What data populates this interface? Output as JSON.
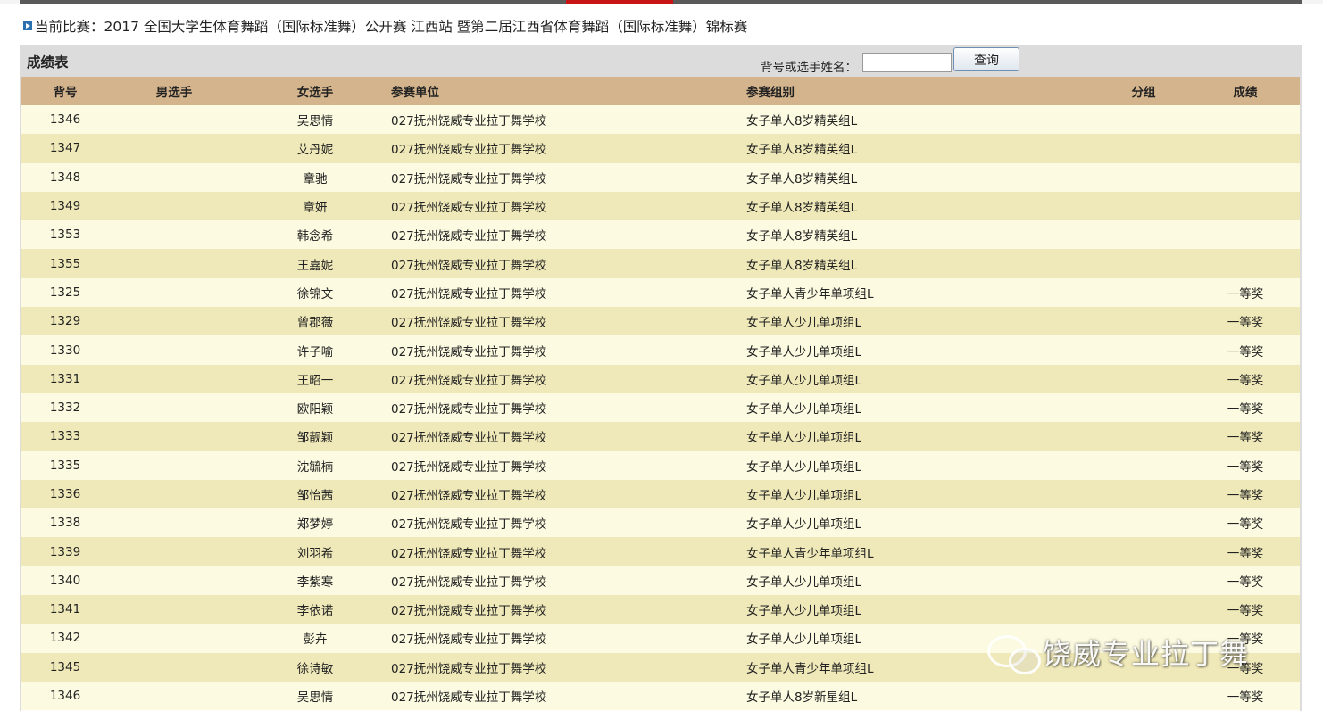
{
  "competition": {
    "prefix": "当前比赛：",
    "name": "2017 全国大学生体育舞蹈（国际标准舞）公开赛  江西站  暨第二届江西省体育舞蹈（国际标准舞）锦标赛"
  },
  "panel": {
    "title": "成绩表",
    "search_label": "背号或选手姓名：",
    "search_value": "",
    "search_button": "查询"
  },
  "table": {
    "columns": [
      "背号",
      "男选手",
      "女选手",
      "参赛单位",
      "参赛组别",
      "分组",
      "成绩"
    ],
    "rows": [
      {
        "no": "1346",
        "male": "",
        "female": "吴思情",
        "unit": "027抚州饶威专业拉丁舞学校",
        "group": "女子单人8岁精英组L",
        "sub": "",
        "result": ""
      },
      {
        "no": "1347",
        "male": "",
        "female": "艾丹妮",
        "unit": "027抚州饶威专业拉丁舞学校",
        "group": "女子单人8岁精英组L",
        "sub": "",
        "result": ""
      },
      {
        "no": "1348",
        "male": "",
        "female": "章驰",
        "unit": "027抚州饶威专业拉丁舞学校",
        "group": "女子单人8岁精英组L",
        "sub": "",
        "result": ""
      },
      {
        "no": "1349",
        "male": "",
        "female": "章妍",
        "unit": "027抚州饶威专业拉丁舞学校",
        "group": "女子单人8岁精英组L",
        "sub": "",
        "result": ""
      },
      {
        "no": "1353",
        "male": "",
        "female": "韩念希",
        "unit": "027抚州饶威专业拉丁舞学校",
        "group": "女子单人8岁精英组L",
        "sub": "",
        "result": ""
      },
      {
        "no": "1355",
        "male": "",
        "female": "王嘉妮",
        "unit": "027抚州饶威专业拉丁舞学校",
        "group": "女子单人8岁精英组L",
        "sub": "",
        "result": ""
      },
      {
        "no": "1325",
        "male": "",
        "female": "徐锦文",
        "unit": "027抚州饶威专业拉丁舞学校",
        "group": "女子单人青少年单项组L",
        "sub": "",
        "result": "一等奖"
      },
      {
        "no": "1329",
        "male": "",
        "female": "曾郡薇",
        "unit": "027抚州饶威专业拉丁舞学校",
        "group": "女子单人少儿单项组L",
        "sub": "",
        "result": "一等奖"
      },
      {
        "no": "1330",
        "male": "",
        "female": "许子喻",
        "unit": "027抚州饶威专业拉丁舞学校",
        "group": "女子单人少儿单项组L",
        "sub": "",
        "result": "一等奖"
      },
      {
        "no": "1331",
        "male": "",
        "female": "王昭一",
        "unit": "027抚州饶威专业拉丁舞学校",
        "group": "女子单人少儿单项组L",
        "sub": "",
        "result": "一等奖"
      },
      {
        "no": "1332",
        "male": "",
        "female": "欧阳颖",
        "unit": "027抚州饶威专业拉丁舞学校",
        "group": "女子单人少儿单项组L",
        "sub": "",
        "result": "一等奖"
      },
      {
        "no": "1333",
        "male": "",
        "female": "邹靓颖",
        "unit": "027抚州饶威专业拉丁舞学校",
        "group": "女子单人少儿单项组L",
        "sub": "",
        "result": "一等奖"
      },
      {
        "no": "1335",
        "male": "",
        "female": "沈毓楠",
        "unit": "027抚州饶威专业拉丁舞学校",
        "group": "女子单人少儿单项组L",
        "sub": "",
        "result": "一等奖"
      },
      {
        "no": "1336",
        "male": "",
        "female": "邹怡茜",
        "unit": "027抚州饶威专业拉丁舞学校",
        "group": "女子单人少儿单项组L",
        "sub": "",
        "result": "一等奖"
      },
      {
        "no": "1338",
        "male": "",
        "female": "郑梦婷",
        "unit": "027抚州饶威专业拉丁舞学校",
        "group": "女子单人少儿单项组L",
        "sub": "",
        "result": "一等奖"
      },
      {
        "no": "1339",
        "male": "",
        "female": "刘羽希",
        "unit": "027抚州饶威专业拉丁舞学校",
        "group": "女子单人青少年单项组L",
        "sub": "",
        "result": "一等奖"
      },
      {
        "no": "1340",
        "male": "",
        "female": "李紫寒",
        "unit": "027抚州饶威专业拉丁舞学校",
        "group": "女子单人少儿单项组L",
        "sub": "",
        "result": "一等奖"
      },
      {
        "no": "1341",
        "male": "",
        "female": "李依诺",
        "unit": "027抚州饶威专业拉丁舞学校",
        "group": "女子单人少儿单项组L",
        "sub": "",
        "result": "一等奖"
      },
      {
        "no": "1342",
        "male": "",
        "female": "彭卉",
        "unit": "027抚州饶威专业拉丁舞学校",
        "group": "女子单人少儿单项组L",
        "sub": "",
        "result": "一等奖"
      },
      {
        "no": "1345",
        "male": "",
        "female": "徐诗敏",
        "unit": "027抚州饶威专业拉丁舞学校",
        "group": "女子单人青少年单项组L",
        "sub": "",
        "result": "一等奖"
      },
      {
        "no": "1346",
        "male": "",
        "female": "吴思情",
        "unit": "027抚州饶威专业拉丁舞学校",
        "group": "女子单人8岁新星组L",
        "sub": "",
        "result": "一等奖"
      }
    ]
  },
  "watermark": {
    "icon": "wechat-icon",
    "text": "饶威专业拉丁舞"
  },
  "colors": {
    "header_bg": "#d4b48c",
    "row_light": "#fcfae0",
    "row_dark": "#efe8b8",
    "panel_bg": "#dcdcdc",
    "top_accent": "#c81414"
  }
}
